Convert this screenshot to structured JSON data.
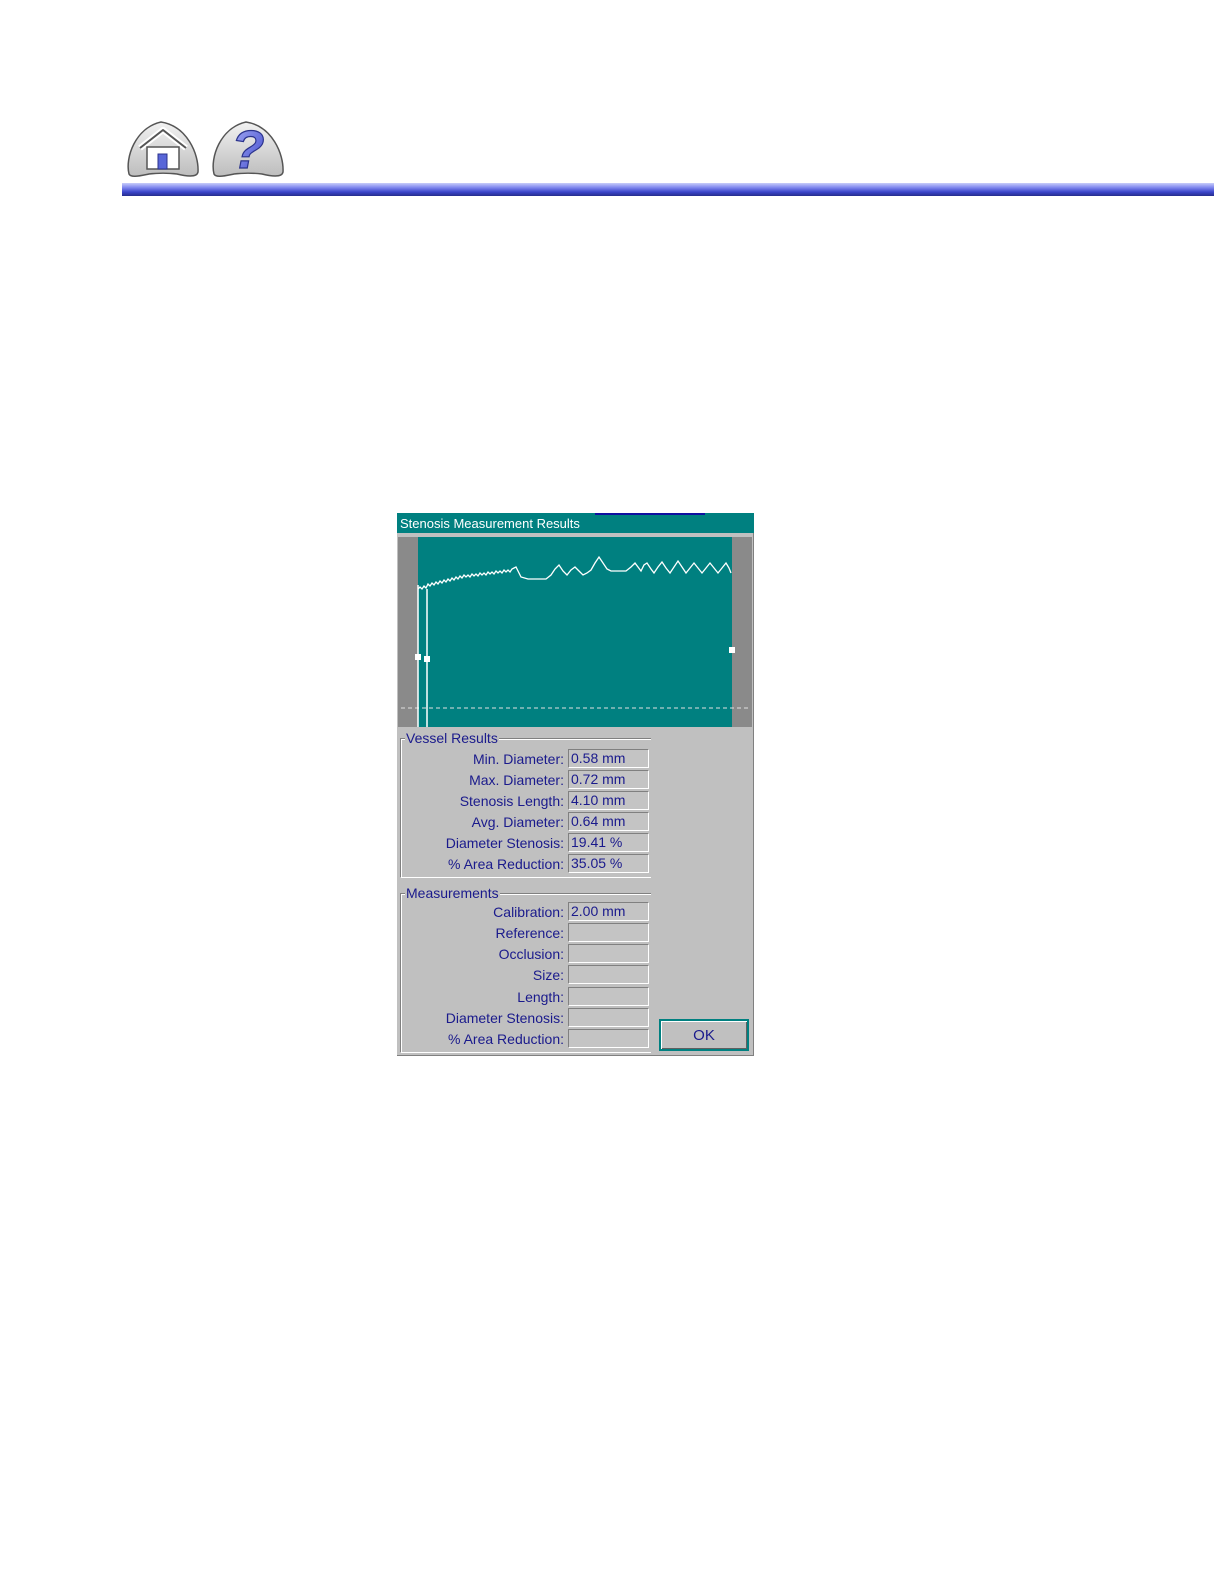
{
  "nav": {
    "home_icon": "home-icon",
    "help_icon": "help-icon",
    "help_glyph": "?"
  },
  "colors": {
    "title_bar": "#008080",
    "graph_background": "#008080",
    "label_text": "#1a1a8c",
    "header_rule": "#3a44c9"
  },
  "dialog": {
    "title": "Stenosis Measurement Results",
    "vessel_results": {
      "legend": "Vessel Results",
      "rows": [
        {
          "label": "Min. Diameter:",
          "value": "0.58 mm"
        },
        {
          "label": "Max. Diameter:",
          "value": "0.72 mm"
        },
        {
          "label": "Stenosis Length:",
          "value": "4.10 mm"
        },
        {
          "label": "Avg. Diameter:",
          "value": "0.64  mm"
        },
        {
          "label": "Diameter Stenosis:",
          "value": "19.41 %"
        },
        {
          "label": "% Area Reduction:",
          "value": "35.05 %"
        }
      ]
    },
    "measurements": {
      "legend": "Measurements",
      "rows": [
        {
          "label": "Calibration:",
          "value": "2.00 mm"
        },
        {
          "label": "Reference:",
          "value": ""
        },
        {
          "label": "Occlusion:",
          "value": ""
        },
        {
          "label": "Size:",
          "value": ""
        },
        {
          "label": "Length:",
          "value": ""
        },
        {
          "label": "Diameter Stenosis:",
          "value": ""
        },
        {
          "label": "% Area Reduction:",
          "value": ""
        }
      ]
    },
    "ok_label": "OK"
  }
}
